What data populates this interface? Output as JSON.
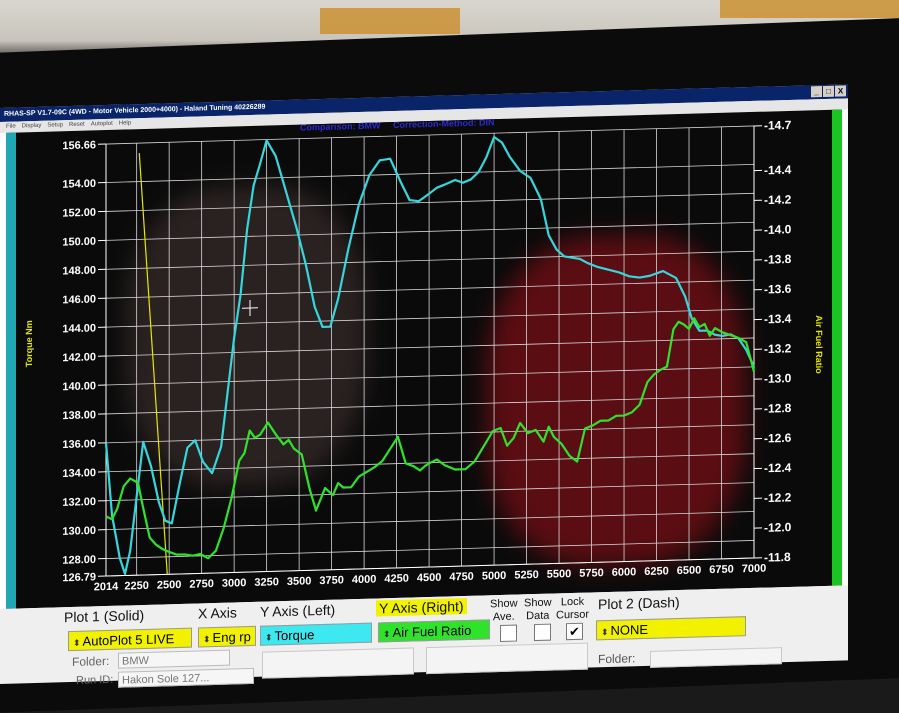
{
  "window": {
    "title": "RHAS-SP V1.7-09C  (4WD - Motor Vehicle 2000+4000) - Haland Tuning 40226289",
    "buttons": [
      "_",
      "□",
      "X"
    ]
  },
  "menu": [
    "File",
    "Display",
    "Setup",
    "Reset",
    "Autoplot",
    "Help"
  ],
  "header": {
    "comparison": "Comparison: BMW",
    "correction": "Correction-Method: DIN"
  },
  "axes": {
    "left_label": "Torque Nm",
    "right_label": "Air Fuel Ratio",
    "left_ticks": [
      "156.66",
      "154.00",
      "152.00",
      "150.00",
      "148.00",
      "146.00",
      "144.00",
      "142.00",
      "140.00",
      "138.00",
      "136.00",
      "134.00",
      "132.00",
      "130.00",
      "128.00",
      "126.79"
    ],
    "right_ticks": [
      "14.7",
      "14.4",
      "14.2",
      "14.0",
      "13.8",
      "13.6",
      "13.4",
      "13.2",
      "13.0",
      "12.8",
      "12.6",
      "12.4",
      "12.2",
      "12.0",
      "11.8"
    ],
    "x_ticks": [
      "2014",
      "2250",
      "2500",
      "2750",
      "3000",
      "3250",
      "3500",
      "3750",
      "4000",
      "4250",
      "4500",
      "4750",
      "5000",
      "5250",
      "5500",
      "5750",
      "6000",
      "6250",
      "6500",
      "6750",
      "7000"
    ]
  },
  "chart_data": {
    "type": "line",
    "xlabel": "",
    "ylabel": "Torque Nm",
    "y2label": "Air Fuel Ratio",
    "xlim": [
      2014,
      7000
    ],
    "ylim": [
      126.79,
      156.66
    ],
    "y2lim": [
      11.8,
      14.7
    ],
    "grid": true,
    "series": [
      {
        "name": "Torque",
        "axis": "left",
        "color": "#35d6dc",
        "x": [
          2014,
          2060,
          2120,
          2160,
          2200,
          2260,
          2300,
          2360,
          2420,
          2470,
          2520,
          2580,
          2640,
          2700,
          2760,
          2830,
          2900,
          2960,
          3000,
          3050,
          3100,
          3150,
          3200,
          3250,
          3320,
          3400,
          3480,
          3550,
          3620,
          3680,
          3740,
          3800,
          3880,
          3960,
          4040,
          4120,
          4200,
          4280,
          4350,
          4420,
          4500,
          4560,
          4620,
          4700,
          4760,
          4820,
          4880,
          4940,
          5000,
          5060,
          5120,
          5200,
          5280,
          5360,
          5420,
          5480,
          5540,
          5600,
          5660,
          5720,
          5800,
          5880,
          5960,
          6040,
          6120,
          6200,
          6300,
          6400,
          6470,
          6520,
          6580,
          6640,
          6700,
          6760,
          6820,
          6880,
          6940,
          7000
        ],
        "values": [
          136.0,
          131.0,
          128.0,
          126.9,
          128.5,
          133.0,
          136.0,
          134.3,
          131.8,
          130.5,
          130.3,
          133.0,
          135.5,
          136.0,
          134.5,
          133.7,
          135.5,
          140.0,
          143.0,
          146.0,
          150.5,
          153.5,
          155.0,
          156.6,
          155.5,
          153.0,
          150.5,
          148.0,
          145.0,
          143.6,
          143.6,
          145.5,
          149.0,
          152.0,
          154.0,
          155.0,
          155.1,
          153.5,
          152.2,
          152.1,
          152.6,
          153.0,
          153.2,
          153.5,
          153.3,
          153.5,
          154.0,
          155.0,
          156.4,
          156.0,
          155.0,
          154.0,
          153.5,
          152.0,
          149.5,
          148.5,
          148.0,
          147.9,
          147.8,
          147.5,
          147.2,
          147.0,
          146.8,
          146.5,
          146.4,
          146.5,
          146.8,
          146.3,
          145.0,
          143.5,
          142.6,
          142.6,
          142.3,
          142.2,
          142.3,
          142.0,
          141.2,
          140.0
        ]
      },
      {
        "name": "Air Fuel Ratio",
        "axis": "right",
        "color": "#2fe22a",
        "x": [
          2014,
          2060,
          2100,
          2150,
          2200,
          2260,
          2300,
          2350,
          2400,
          2450,
          2500,
          2560,
          2620,
          2680,
          2740,
          2800,
          2860,
          2920,
          2980,
          3040,
          3080,
          3120,
          3160,
          3200,
          3260,
          3320,
          3380,
          3420,
          3460,
          3520,
          3580,
          3630,
          3700,
          3760,
          3800,
          3840,
          3900,
          3960,
          4020,
          4080,
          4140,
          4200,
          4260,
          4320,
          4380,
          4430,
          4470,
          4510,
          4560,
          4620,
          4700,
          4780,
          4850,
          4920,
          4990,
          5050,
          5100,
          5150,
          5200,
          5260,
          5320,
          5380,
          5420,
          5460,
          5520,
          5580,
          5640,
          5700,
          5760,
          5820,
          5880,
          5940,
          6000,
          6060,
          6120,
          6180,
          6230,
          6280,
          6330,
          6380,
          6420,
          6460,
          6500,
          6540,
          6580,
          6620,
          6660,
          6700,
          6760,
          6820,
          6880,
          6940,
          7000
        ],
        "values": [
          12.2,
          12.18,
          12.25,
          12.4,
          12.45,
          12.42,
          12.25,
          12.05,
          12.0,
          11.97,
          11.95,
          11.93,
          11.93,
          11.92,
          11.93,
          11.9,
          11.95,
          12.1,
          12.3,
          12.55,
          12.6,
          12.75,
          12.7,
          12.72,
          12.8,
          12.72,
          12.65,
          12.68,
          12.62,
          12.58,
          12.35,
          12.2,
          12.35,
          12.3,
          12.38,
          12.35,
          12.35,
          12.42,
          12.45,
          12.48,
          12.52,
          12.6,
          12.68,
          12.5,
          12.48,
          12.45,
          12.48,
          12.5,
          12.52,
          12.48,
          12.45,
          12.45,
          12.5,
          12.6,
          12.7,
          12.72,
          12.6,
          12.65,
          12.75,
          12.68,
          12.7,
          12.62,
          12.72,
          12.65,
          12.6,
          12.52,
          12.48,
          12.7,
          12.72,
          12.75,
          12.75,
          12.78,
          12.78,
          12.8,
          12.85,
          13.0,
          13.05,
          13.08,
          13.1,
          13.35,
          13.4,
          13.38,
          13.35,
          13.42,
          13.36,
          13.38,
          13.3,
          13.35,
          13.32,
          13.3,
          13.28,
          13.25,
          13.05
        ]
      }
    ],
    "cursor_rpm": 2270
  },
  "controls": {
    "plot1_label": "Plot 1 (Solid)",
    "xaxis_label": "X Axis",
    "yaxis_left_label": "Y Axis (Left)",
    "yaxis_right_label": "Y Axis (Right)",
    "show_ave": "Show\nAve.",
    "show_data": "Show\nData",
    "lock_cursor": "Lock\nCursor",
    "plot2_label": "Plot 2 (Dash)",
    "plot1_value": "AutoPlot 5 LIVE",
    "xaxis_value": "Eng rp",
    "yleft_value": "Torque",
    "yright_value": "Air Fuel Ratio",
    "plot2_value": "NONE",
    "folder_label": "Folder:",
    "folder_value": "BMW",
    "folder2_label": "Folder:",
    "run_label": "Run ID:",
    "run_value": "Hakon Sole 127...",
    "lock_cursor_checked": "✔",
    "colors": {
      "yellow": "#f2f200",
      "cyan": "#3ee8f0",
      "green": "#2fe22a"
    }
  }
}
